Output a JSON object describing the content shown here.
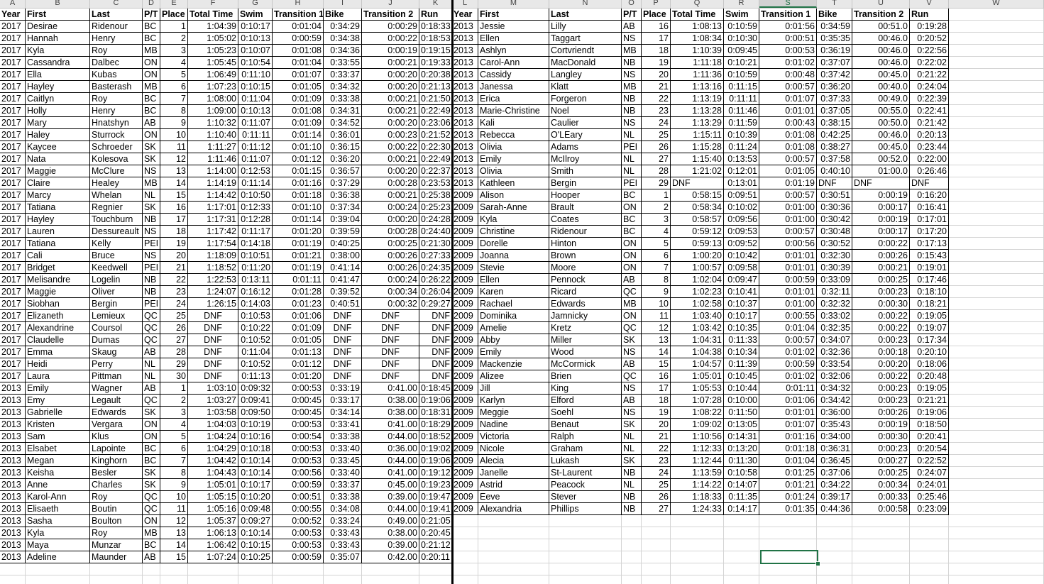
{
  "column_letters": [
    "A",
    "B",
    "C",
    "D",
    "E",
    "F",
    "G",
    "H",
    "I",
    "J",
    "K",
    "L",
    "M",
    "N",
    "O",
    "P",
    "Q",
    "R",
    "S",
    "T",
    "U",
    "V",
    "W"
  ],
  "selected_column": "S",
  "headers": [
    "Year",
    "First",
    "Last",
    "P/T",
    "Place",
    "Total Time",
    "Swim",
    "Transition 1",
    "Bike",
    "Transition 2",
    "Run"
  ],
  "left_rows": [
    [
      "2017",
      "Desirae",
      "Ridenour",
      "BC",
      "1",
      "1:04:39",
      "0:10:17",
      "0:01:04",
      "0:34:29",
      "0:00:29",
      "0:18:33"
    ],
    [
      "2017",
      "Hannah",
      "Henry",
      "BC",
      "2",
      "1:05:02",
      "0:10:13",
      "0:00:59",
      "0:34:38",
      "0:00:22",
      "0:18:53"
    ],
    [
      "2017",
      "Kyla",
      "Roy",
      "MB",
      "3",
      "1:05:23",
      "0:10:07",
      "0:01:08",
      "0:34:36",
      "0:00:19",
      "0:19:15"
    ],
    [
      "2017",
      "Cassandra",
      "Dalbec",
      "ON",
      "4",
      "1:05:45",
      "0:10:54",
      "0:01:04",
      "0:33:55",
      "0:00:21",
      "0:19:33"
    ],
    [
      "2017",
      "Ella",
      "Kubas",
      "ON",
      "5",
      "1:06:49",
      "0:11:10",
      "0:01:07",
      "0:33:37",
      "0:00:20",
      "0:20:38"
    ],
    [
      "2017",
      "Hayley",
      "Basterash",
      "MB",
      "6",
      "1:07:23",
      "0:10:15",
      "0:01:05",
      "0:34:32",
      "0:00:20",
      "0:21:13"
    ],
    [
      "2017",
      "Caitlyn",
      "Roy",
      "BC",
      "7",
      "1:08:00",
      "0:11:04",
      "0:01:09",
      "0:33:38",
      "0:00:21",
      "0:21:50"
    ],
    [
      "2017",
      "Holly",
      "Henry",
      "BC",
      "8",
      "1:09:00",
      "0:10:13",
      "0:01:08",
      "0:34:31",
      "0:00:21",
      "0:22:49"
    ],
    [
      "2017",
      "Mary",
      "Hnatshyn",
      "AB",
      "9",
      "1:10:32",
      "0:11:07",
      "0:01:09",
      "0:34:52",
      "0:00:20",
      "0:23:06"
    ],
    [
      "2017",
      "Haley",
      "Sturrock",
      "ON",
      "10",
      "1:10:40",
      "0:11:11",
      "0:01:14",
      "0:36:01",
      "0:00:23",
      "0:21:52"
    ],
    [
      "2017",
      "Kaycee",
      "Schroeder",
      "SK",
      "11",
      "1:11:27",
      "0:11:12",
      "0:01:10",
      "0:36:15",
      "0:00:22",
      "0:22:30"
    ],
    [
      "2017",
      "Nata",
      "Kolesova",
      "SK",
      "12",
      "1:11:46",
      "0:11:07",
      "0:01:12",
      "0:36:20",
      "0:00:21",
      "0:22:49"
    ],
    [
      "2017",
      "Maggie",
      "McClure",
      "NS",
      "13",
      "1:14:00",
      "0:12:53",
      "0:01:15",
      "0:36:57",
      "0:00:20",
      "0:22:37"
    ],
    [
      "2017",
      "Claire",
      "Healey",
      "MB",
      "14",
      "1:14:19",
      "0:11:14",
      "0:01:16",
      "0:37:29",
      "0:00:28",
      "0:23:53"
    ],
    [
      "2017",
      "Marcy",
      "Whelan",
      "NL",
      "15",
      "1:14:42",
      "0:10:50",
      "0:01:18",
      "0:36:38",
      "0:00:21",
      "0:25:38"
    ],
    [
      "2017",
      "Tatiana",
      "Regnier",
      "SK",
      "16",
      "1:17:01",
      "0:12:33",
      "0:01:10",
      "0:37:34",
      "0:00:24",
      "0:25:23"
    ],
    [
      "2017",
      "Hayley",
      "Touchburn",
      "NB",
      "17",
      "1:17:31",
      "0:12:28",
      "0:01:14",
      "0:39:04",
      "0:00:20",
      "0:24:28"
    ],
    [
      "2017",
      "Lauren",
      "Dessureault",
      "NS",
      "18",
      "1:17:42",
      "0:11:17",
      "0:01:20",
      "0:39:59",
      "0:00:28",
      "0:24:40"
    ],
    [
      "2017",
      "Tatiana",
      "Kelly",
      "PEI",
      "19",
      "1:17:54",
      "0:14:18",
      "0:01:19",
      "0:40:25",
      "0:00:25",
      "0:21:30"
    ],
    [
      "2017",
      "Cali",
      "Bruce",
      "NS",
      "20",
      "1:18:09",
      "0:10:51",
      "0:01:21",
      "0:38:00",
      "0:00:26",
      "0:27:33"
    ],
    [
      "2017",
      "Bridget",
      "Keedwell",
      "PEI",
      "21",
      "1:18:52",
      "0:11:20",
      "0:01:19",
      "0:41:14",
      "0:00:26",
      "0:24:35"
    ],
    [
      "2017",
      "Melisandre",
      "Logelin",
      "NB",
      "22",
      "1:22:53",
      "0:13:11",
      "0:01:11",
      "0:41:47",
      "0:00:24",
      "0:26:22"
    ],
    [
      "2017",
      "Maggie",
      "Oliver",
      "NB",
      "23",
      "1:24:07",
      "0:16:12",
      "0:01:28",
      "0:39:52",
      "0:00:34",
      "0:26:04"
    ],
    [
      "2017",
      "Siobhan",
      "Bergin",
      "PEI",
      "24",
      "1:26:15",
      "0:14:03",
      "0:01:23",
      "0:40:51",
      "0:00:32",
      "0:29:27"
    ],
    [
      "2017",
      "Elizaneth",
      "Lemieux",
      "QC",
      "25",
      "DNF",
      "0:10:53",
      "0:01:06",
      "DNF",
      "DNF",
      "DNF"
    ],
    [
      "2017",
      "Alexandrine",
      "Coursol",
      "QC",
      "26",
      "DNF",
      "0:10:22",
      "0:01:09",
      "DNF",
      "DNF",
      "DNF"
    ],
    [
      "2017",
      "Claudelle",
      "Dumas",
      "QC",
      "27",
      "DNF",
      "0:10:52",
      "0:01:05",
      "DNF",
      "DNF",
      "DNF"
    ],
    [
      "2017",
      "Emma",
      "Skaug",
      "AB",
      "28",
      "DNF",
      "0:11:04",
      "0:01:13",
      "DNF",
      "DNF",
      "DNF"
    ],
    [
      "2017",
      "Heidi",
      "Perry",
      "NL",
      "29",
      "DNF",
      "0:10:52",
      "0:01:12",
      "DNF",
      "DNF",
      "DNF"
    ],
    [
      "2017",
      "Laura",
      "Pittman",
      "NL",
      "30",
      "DNF",
      "0:11:13",
      "0:01:20",
      "DNF",
      "DNF",
      "DNF"
    ],
    [
      "2013",
      "Emily",
      "Wagner",
      "AB",
      "1",
      "1:03:10",
      "0:09:32",
      "0:00:53",
      "0:33:19",
      "0:41.00",
      "0:18:45"
    ],
    [
      "2013",
      "Emy",
      "Legault",
      "QC",
      "2",
      "1:03:27",
      "0:09:41",
      "0:00:45",
      "0:33:17",
      "0:38.00",
      "0:19:06"
    ],
    [
      "2013",
      "Gabrielle",
      "Edwards",
      "SK",
      "3",
      "1:03:58",
      "0:09:50",
      "0:00:45",
      "0:34:14",
      "0:38.00",
      "0:18:31"
    ],
    [
      "2013",
      "Kristen",
      "Vergara",
      "ON",
      "4",
      "1:04:03",
      "0:10:19",
      "0:00:53",
      "0:33:41",
      "0:41.00",
      "0:18:29"
    ],
    [
      "2013",
      "Sam",
      "Klus",
      "ON",
      "5",
      "1:04:24",
      "0:10:16",
      "0:00:54",
      "0:33:38",
      "0:44.00",
      "0:18:52"
    ],
    [
      "2013",
      "Elsabet",
      "Lapointe",
      "BC",
      "6",
      "1:04:29",
      "0:10:18",
      "0:00:53",
      "0:33:40",
      "0:36.00",
      "0:19:02"
    ],
    [
      "2013",
      "Megan",
      "Kinghorn",
      "BC",
      "7",
      "1:04:42",
      "0:10:14",
      "0:00:53",
      "0:33:45",
      "0:44.00",
      "0:19:06"
    ],
    [
      "2013",
      "Keisha",
      "Besler",
      "SK",
      "8",
      "1:04:43",
      "0:10:14",
      "0:00:56",
      "0:33:40",
      "0:41.00",
      "0:19:12"
    ],
    [
      "2013",
      "Anne",
      "Charles",
      "SK",
      "9",
      "1:05:01",
      "0:10:17",
      "0:00:59",
      "0:33:37",
      "0:45.00",
      "0:19:23"
    ],
    [
      "2013",
      "Karol-Ann",
      "Roy",
      "QC",
      "10",
      "1:05:15",
      "0:10:20",
      "0:00:51",
      "0:33:38",
      "0:39.00",
      "0:19:47"
    ],
    [
      "2013",
      "Elisaeth",
      "Boutin",
      "QC",
      "11",
      "1:05:16",
      "0:09:48",
      "0:00:55",
      "0:34:08",
      "0:44.00",
      "0:19:41"
    ],
    [
      "2013",
      "Sasha",
      "Boulton",
      "ON",
      "12",
      "1:05:37",
      "0:09:27",
      "0:00:52",
      "0:33:24",
      "0:49.00",
      "0:21:05"
    ],
    [
      "2013",
      "Kyla",
      "Roy",
      "MB",
      "13",
      "1:06:13",
      "0:10:14",
      "0:00:53",
      "0:33:43",
      "0:38.00",
      "0:20:45"
    ],
    [
      "2013",
      "Maya",
      "Munzar",
      "BC",
      "14",
      "1:06:42",
      "0:10:15",
      "0:00:53",
      "0:33:43",
      "0:39.00",
      "0:21:12"
    ],
    [
      "2013",
      "Adeline",
      "Maunder",
      "AB",
      "15",
      "1:07:24",
      "0:10:25",
      "0:00:59",
      "0:35:07",
      "0:42.00",
      "0:20:11"
    ]
  ],
  "right_rows": [
    [
      "2013",
      "Jessie",
      "Lilly",
      "AB",
      "16",
      "1:08:13",
      "0:10:59",
      "0:01:56",
      "0:34:59",
      "00:51.0",
      "0:19:28"
    ],
    [
      "2013",
      "Ellen",
      "Taggart",
      "NS",
      "17",
      "1:08:34",
      "0:10:30",
      "0:00:51",
      "0:35:35",
      "00:46.0",
      "0:20:52"
    ],
    [
      "2013",
      "Ashlyn",
      "Cortvriendt",
      "MB",
      "18",
      "1:10:39",
      "0:09:45",
      "0:00:53",
      "0:36:19",
      "00:46.0",
      "0:22:56"
    ],
    [
      "2013",
      "Carol-Ann",
      "MacDonald",
      "NB",
      "19",
      "1:11:18",
      "0:10:21",
      "0:01:02",
      "0:37:07",
      "00:46.0",
      "0:22:02"
    ],
    [
      "2013",
      "Cassidy",
      "Langley",
      "NS",
      "20",
      "1:11:36",
      "0:10:59",
      "0:00:48",
      "0:37:42",
      "00:45.0",
      "0:21:22"
    ],
    [
      "2013",
      "Janessa",
      "Klatt",
      "MB",
      "21",
      "1:13:16",
      "0:11:15",
      "0:00:57",
      "0:36:20",
      "00:40.0",
      "0:24:04"
    ],
    [
      "2013",
      "Erica",
      "Forgeron",
      "NB",
      "22",
      "1:13:19",
      "0:11:11",
      "0:01:07",
      "0:37:33",
      "00:49.0",
      "0:22:39"
    ],
    [
      "2013",
      "Marie-Christine",
      "Noel",
      "NB",
      "23",
      "1:13:28",
      "0:11:46",
      "0:01:01",
      "0:37:05",
      "00:55.0",
      "0:22:41"
    ],
    [
      "2013",
      "Kali",
      "Caulier",
      "NS",
      "24",
      "1:13:29",
      "0:11:59",
      "0:00:43",
      "0:38:15",
      "00:50.0",
      "0:21:42"
    ],
    [
      "2013",
      "Rebecca",
      "O'LEary",
      "NL",
      "25",
      "1:15:11",
      "0:10:39",
      "0:01:08",
      "0:42:25",
      "00:46.0",
      "0:20:13"
    ],
    [
      "2013",
      "Olivia",
      "Adams",
      "PEI",
      "26",
      "1:15:28",
      "0:11:24",
      "0:01:08",
      "0:38:27",
      "00:45.0",
      "0:23:44"
    ],
    [
      "2013",
      "Emily",
      "McIlroy",
      "NL",
      "27",
      "1:15:40",
      "0:13:53",
      "0:00:57",
      "0:37:58",
      "00:52.0",
      "0:22:00"
    ],
    [
      "2013",
      "Olivia",
      "Smith",
      "NL",
      "28",
      "1:21:02",
      "0:12:01",
      "0:01:05",
      "0:40:10",
      "01:00.0",
      "0:26:46"
    ],
    [
      "2013",
      "Kathleen",
      "Bergin",
      "PEI",
      "29",
      "DNF",
      "0:13:01",
      "0:01:19",
      "DNF",
      "DNF",
      "DNF"
    ],
    [
      "2009",
      "Alison",
      "Hooper",
      "BC",
      "1",
      "0:58:15",
      "0:09:51",
      "0:00:57",
      "0:30:51",
      "0:00:19",
      "0:16:20"
    ],
    [
      "2009",
      "Sarah-Anne",
      "Brault",
      "ON",
      "2",
      "0:58:34",
      "0:10:02",
      "0:01:00",
      "0:30:36",
      "0:00:17",
      "0:16:41"
    ],
    [
      "2009",
      "Kyla",
      "Coates",
      "BC",
      "3",
      "0:58:57",
      "0:09:56",
      "0:01:00",
      "0:30:42",
      "0:00:19",
      "0:17:01"
    ],
    [
      "2009",
      "Christine",
      "Ridenour",
      "BC",
      "4",
      "0:59:12",
      "0:09:53",
      "0:00:57",
      "0:30:48",
      "0:00:17",
      "0:17:20"
    ],
    [
      "2009",
      "Dorelle",
      "Hinton",
      "ON",
      "5",
      "0:59:13",
      "0:09:52",
      "0:00:56",
      "0:30:52",
      "0:00:22",
      "0:17:13"
    ],
    [
      "2009",
      "Joanna",
      "Brown",
      "ON",
      "6",
      "1:00:20",
      "0:10:42",
      "0:01:01",
      "0:32:30",
      "0:00:26",
      "0:15:43"
    ],
    [
      "2009",
      "Stevie",
      "Moore",
      "ON",
      "7",
      "1:00:57",
      "0:09:58",
      "0:01:01",
      "0:30:39",
      "0:00:21",
      "0:19:01"
    ],
    [
      "2009",
      "Ellen",
      "Pennock",
      "AB",
      "8",
      "1:02:04",
      "0:09:47",
      "0:00:59",
      "0:33:09",
      "0:00:25",
      "0:17:46"
    ],
    [
      "2009",
      "Karen",
      "Ricard",
      "QC",
      "9",
      "1:02:23",
      "0:10:41",
      "0:01:01",
      "0:32:11",
      "0:00:23",
      "0:18:10"
    ],
    [
      "2009",
      "Rachael",
      "Edwards",
      "MB",
      "10",
      "1:02:58",
      "0:10:37",
      "0:01:00",
      "0:32:32",
      "0:00:30",
      "0:18:21"
    ],
    [
      "2009",
      "Dominika",
      "Jamnicky",
      "ON",
      "11",
      "1:03:40",
      "0:10:17",
      "0:00:55",
      "0:33:02",
      "0:00:22",
      "0:19:05"
    ],
    [
      "2009",
      "Amelie",
      "Kretz",
      "QC",
      "12",
      "1:03:42",
      "0:10:35",
      "0:01:04",
      "0:32:35",
      "0:00:22",
      "0:19:07"
    ],
    [
      "2009",
      "Abby",
      "Miller",
      "SK",
      "13",
      "1:04:31",
      "0:11:33",
      "0:00:57",
      "0:34:07",
      "0:00:23",
      "0:17:34"
    ],
    [
      "2009",
      "Emily",
      "Wood",
      "NS",
      "14",
      "1:04:38",
      "0:10:34",
      "0:01:02",
      "0:32:36",
      "0:00:18",
      "0:20:10"
    ],
    [
      "2009",
      "Mackenzie",
      "McCormick",
      "AB",
      "15",
      "1:04:57",
      "0:11:39",
      "0:00:59",
      "0:33:54",
      "0:00:20",
      "0:18:06"
    ],
    [
      "2009",
      "Alizee",
      "Brien",
      "QC",
      "16",
      "1:05:01",
      "0:10:45",
      "0:01:02",
      "0:32:06",
      "0:00:22",
      "0:20:48"
    ],
    [
      "2009",
      "Jill",
      "King",
      "NS",
      "17",
      "1:05:53",
      "0:10:44",
      "0:01:11",
      "0:34:32",
      "0:00:23",
      "0:19:05"
    ],
    [
      "2009",
      "Karlyn",
      "Elford",
      "AB",
      "18",
      "1:07:28",
      "0:10:00",
      "0:01:06",
      "0:34:42",
      "0:00:23",
      "0:21:21"
    ],
    [
      "2009",
      "Meggie",
      "Soehl",
      "NS",
      "19",
      "1:08:22",
      "0:11:50",
      "0:01:01",
      "0:36:00",
      "0:00:26",
      "0:19:06"
    ],
    [
      "2009",
      "Nadine",
      "Benaut",
      "SK",
      "20",
      "1:09:02",
      "0:13:05",
      "0:01:07",
      "0:35:43",
      "0:00:19",
      "0:18:50"
    ],
    [
      "2009",
      "Victoria",
      "Ralph",
      "NL",
      "21",
      "1:10:56",
      "0:14:31",
      "0:01:16",
      "0:34:00",
      "0:00:30",
      "0:20:41"
    ],
    [
      "2009",
      "Nicole",
      "Graham",
      "NL",
      "22",
      "1:12:33",
      "0:13:20",
      "0:01:18",
      "0:36:31",
      "0:00:23",
      "0:20:54"
    ],
    [
      "2009",
      "Alecia",
      "Lukash",
      "SK",
      "23",
      "1:12:44",
      "0:11:30",
      "0:01:04",
      "0:36:45",
      "0:00:27",
      "0:22:52"
    ],
    [
      "2009",
      "Janelle",
      "St-Laurent",
      "NB",
      "24",
      "1:13:59",
      "0:10:58",
      "0:01:25",
      "0:37:06",
      "0:00:25",
      "0:24:07"
    ],
    [
      "2009",
      "Astrid",
      "Peacock",
      "NL",
      "25",
      "1:14:22",
      "0:14:07",
      "0:01:21",
      "0:34:22",
      "0:00:34",
      "0:24:01"
    ],
    [
      "2009",
      "Eeve",
      "Stever",
      "NB",
      "26",
      "1:18:33",
      "0:11:35",
      "0:01:24",
      "0:39:17",
      "0:00:33",
      "0:25:46"
    ],
    [
      "2009",
      "Alexandria",
      "Phillips",
      "NB",
      "27",
      "1:24:33",
      "0:14:17",
      "0:01:35",
      "0:44:36",
      "0:00:58",
      "0:23:09"
    ]
  ]
}
